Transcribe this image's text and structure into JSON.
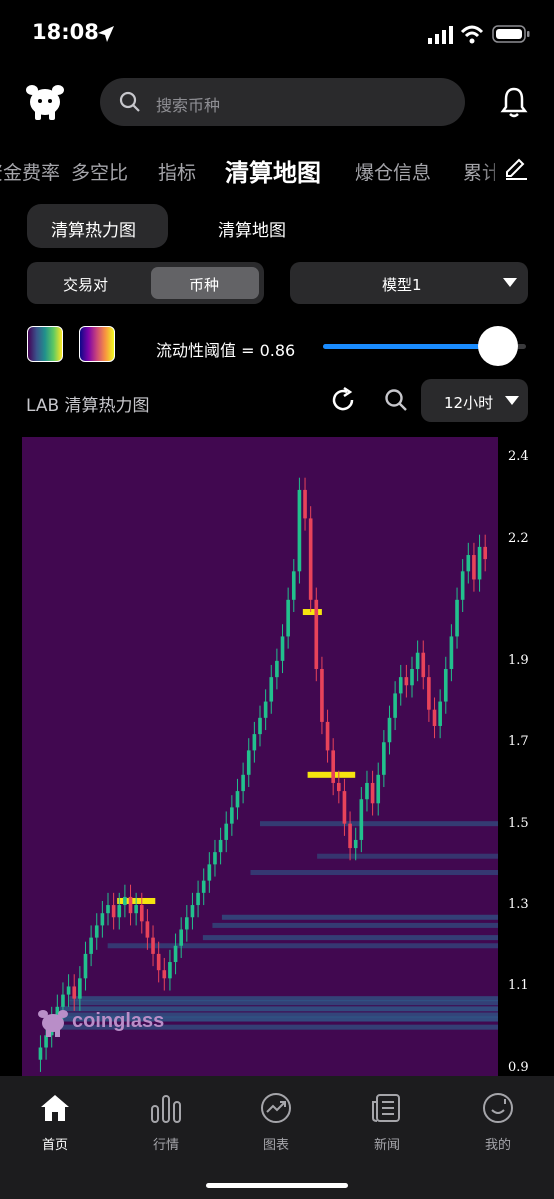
{
  "status": {
    "time": "18:08"
  },
  "search": {
    "placeholder": "搜索币种"
  },
  "tabs": [
    "资金费率",
    "多空比",
    "指标",
    "清算地图",
    "爆仓信息",
    "累计"
  ],
  "active_tab_index": 3,
  "subtabs": [
    "清算热力图",
    "清算地图"
  ],
  "segment": [
    "交易对",
    "币种"
  ],
  "model_select": "模型1",
  "threshold": {
    "label": "流动性阈值 = 0.86",
    "value": 0.86
  },
  "chart_header": {
    "title": "LAB 清算热力图",
    "interval": "12小时"
  },
  "colors": {
    "heatmap_bg": "#410850",
    "bull": "#22c08d",
    "bear": "#e8435a",
    "liq_band": "#2d5f8c",
    "liq_hot": "#f5e50f",
    "accent": "#1a8cff"
  },
  "chart_data": {
    "type": "heatmap",
    "y_ticks": [
      "2.4",
      "2.2",
      "1.9",
      "1.7",
      "1.5",
      "1.3",
      "1.1",
      "0.9"
    ],
    "y_values": [
      2.4,
      2.2,
      1.9,
      1.7,
      1.5,
      1.3,
      1.1,
      0.9
    ],
    "ylim": [
      0.88,
      2.45
    ],
    "watermark": "coinglass",
    "price_path": [
      0.92,
      0.95,
      0.98,
      1.02,
      1.05,
      1.08,
      1.1,
      1.07,
      1.12,
      1.18,
      1.22,
      1.25,
      1.28,
      1.3,
      1.27,
      1.3,
      1.32,
      1.28,
      1.3,
      1.26,
      1.22,
      1.18,
      1.14,
      1.12,
      1.16,
      1.2,
      1.24,
      1.27,
      1.3,
      1.33,
      1.36,
      1.4,
      1.43,
      1.46,
      1.5,
      1.54,
      1.58,
      1.62,
      1.68,
      1.72,
      1.76,
      1.8,
      1.86,
      1.9,
      1.96,
      2.05,
      2.12,
      2.32,
      2.25,
      2.05,
      1.88,
      1.75,
      1.68,
      1.6,
      1.58,
      1.5,
      1.44,
      1.46,
      1.56,
      1.6,
      1.55,
      1.62,
      1.7,
      1.76,
      1.82,
      1.86,
      1.84,
      1.88,
      1.92,
      1.86,
      1.78,
      1.74,
      1.8,
      1.88,
      1.96,
      2.05,
      2.12,
      2.16,
      2.1,
      2.18,
      2.15
    ],
    "liquidation_levels": [
      {
        "price": 1.27,
        "intensity": 0.5,
        "x_start": 0.42
      },
      {
        "price": 1.25,
        "intensity": 0.4,
        "x_start": 0.4
      },
      {
        "price": 1.22,
        "intensity": 0.45,
        "x_start": 0.38
      },
      {
        "price": 1.2,
        "intensity": 0.35,
        "x_start": 0.18
      },
      {
        "price": 1.07,
        "intensity": 0.55,
        "x_start": 0.1
      },
      {
        "price": 1.06,
        "intensity": 0.5,
        "x_start": 0.1
      },
      {
        "price": 1.045,
        "intensity": 0.7,
        "x_start": 0.08
      },
      {
        "price": 1.03,
        "intensity": 0.6,
        "x_start": 0.08
      },
      {
        "price": 1.02,
        "intensity": 0.7,
        "x_start": 0.06
      },
      {
        "price": 1.0,
        "intensity": 0.45,
        "x_start": 0.06
      },
      {
        "price": 1.5,
        "intensity": 0.4,
        "x_start": 0.5
      },
      {
        "price": 1.38,
        "intensity": 0.35,
        "x_start": 0.48
      },
      {
        "price": 1.42,
        "intensity": 0.3,
        "x_start": 0.62
      },
      {
        "price": 2.02,
        "intensity": 1.0,
        "x_start": 0.59,
        "x_end": 0.63
      },
      {
        "price": 1.62,
        "intensity": 1.0,
        "x_start": 0.6,
        "x_end": 0.7
      },
      {
        "price": 1.31,
        "intensity": 1.0,
        "x_start": 0.2,
        "x_end": 0.28
      }
    ]
  },
  "bottom_nav": [
    "首页",
    "行情",
    "图表",
    "新闻",
    "我的"
  ]
}
